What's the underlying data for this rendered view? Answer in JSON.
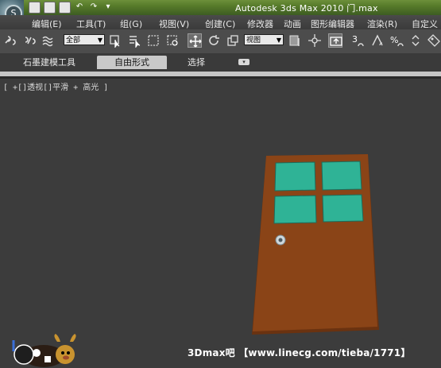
{
  "app": {
    "window_title": "Autodesk 3ds Max  2010        门.max",
    "logo_letter": "S"
  },
  "menu": {
    "items": [
      "编辑(E)",
      "工具(T)",
      "组(G)",
      "视图(V)",
      "创建(C)",
      "修改器",
      "动画",
      "图形编辑器",
      "渲染(R)",
      "自定义"
    ]
  },
  "toolbar": {
    "selection_filter": "全部",
    "reference_coord": "视图",
    "snap_label": "3"
  },
  "ribbon": {
    "tabs": [
      "石墨建模工具",
      "自由形式",
      "选择"
    ],
    "selected_tab": "自由形式"
  },
  "viewport": {
    "label": "[ +[]透视[]平滑 + 高光 ]",
    "background": "#3c3c3c"
  },
  "scene": {
    "door_color": "#8a4417",
    "door_edge_color": "#6a3210",
    "glass_color": "#2fb396",
    "knob_color": "#cfd8dc"
  },
  "watermark": {
    "text": "3Dmax吧 【www.linecg.com/tieba/1771】"
  }
}
